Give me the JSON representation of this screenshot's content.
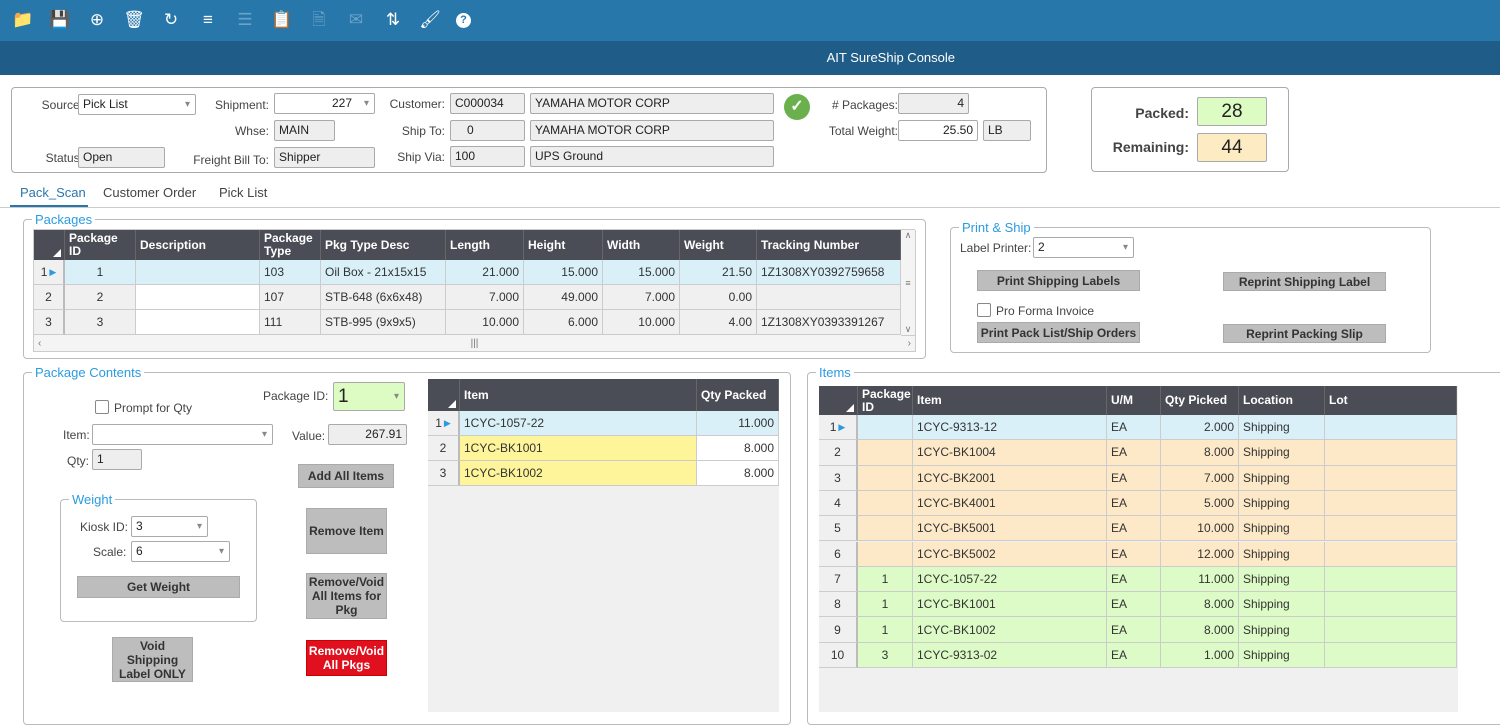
{
  "toolbar": {
    "icons": [
      {
        "name": "folder-open-icon",
        "glyph": "📁",
        "enabled": true
      },
      {
        "name": "save-icon",
        "glyph": "💾",
        "enabled": false
      },
      {
        "name": "crosshair-icon",
        "glyph": "⊕",
        "enabled": true
      },
      {
        "name": "trash-icon",
        "glyph": "🗑",
        "enabled": true
      },
      {
        "name": "refresh-icon",
        "glyph": "↻",
        "enabled": true
      },
      {
        "name": "filter-icon",
        "glyph": "≡",
        "enabled": true
      },
      {
        "name": "rows-icon",
        "glyph": "☰",
        "enabled": false
      },
      {
        "name": "clipboard-icon",
        "glyph": "📋",
        "enabled": false
      },
      {
        "name": "document-search-icon",
        "glyph": "🗎",
        "enabled": false
      },
      {
        "name": "envelope-icon",
        "glyph": "✉",
        "enabled": false
      },
      {
        "name": "box-arrow-icon",
        "glyph": "⇅",
        "enabled": true
      },
      {
        "name": "brush-icon",
        "glyph": "🖌",
        "enabled": true
      },
      {
        "name": "help-icon",
        "glyph": "?",
        "enabled": true
      }
    ]
  },
  "title": "AIT SureShip Console",
  "header": {
    "source_label": "Source:",
    "source": "Pick List",
    "status_label": "Status:",
    "status": "Open",
    "shipment_label": "Shipment:",
    "shipment": "227",
    "whse_label": "Whse:",
    "whse": "MAIN",
    "freight_label": "Freight Bill To:",
    "freight": "Shipper",
    "customer_label": "Customer:",
    "customer_id": "C000034",
    "customer_name": "YAMAHA MOTOR CORP",
    "shipto_label": "Ship To:",
    "shipto_id": "0",
    "shipto_name": "YAMAHA MOTOR CORP",
    "shipvia_label": "Ship Via:",
    "shipvia_id": "100",
    "shipvia_name": "UPS Ground",
    "packages_label": "# Packages:",
    "packages": "4",
    "weight_label": "Total Weight:",
    "weight": "25.50",
    "weight_unit": "LB",
    "status_icon": "check-circle-icon",
    "status_color": "#6ab04c"
  },
  "summary": {
    "packed_label": "Packed:",
    "packed": "28",
    "packed_color": "#dcfcc4",
    "remaining_label": "Remaining:",
    "remaining": "44",
    "remaining_color": "#fdebc4"
  },
  "tabs": [
    {
      "label": "Pack_Scan",
      "active": true
    },
    {
      "label": "Customer Order"
    },
    {
      "label": "Pick List"
    }
  ],
  "packages": {
    "legend": "Packages",
    "columns": [
      "Package ID",
      "Description",
      "Package Type",
      "Pkg Type Desc",
      "Length",
      "Height",
      "Width",
      "Weight",
      "Tracking Number"
    ],
    "rows": [
      [
        "1",
        "",
        "103",
        "Oil Box - 21x15x15",
        "21.000",
        "15.000",
        "15.000",
        "21.50",
        "1Z1308XY0392759658"
      ],
      [
        "2",
        "",
        "107",
        "STB-648 (6x6x48)",
        "7.000",
        "49.000",
        "7.000",
        "0.00",
        ""
      ],
      [
        "3",
        "",
        "111",
        "STB-995 (9x9x5)",
        "10.000",
        "6.000",
        "10.000",
        "4.00",
        "1Z1308XY0393391267"
      ]
    ]
  },
  "print_ship": {
    "legend": "Print & Ship",
    "printer_label": "Label Printer:",
    "printer": "2",
    "print_labels": "Print Shipping Labels",
    "reprint_label": "Reprint Shipping Label",
    "pro_forma": "Pro Forma Invoice",
    "print_pack": "Print Pack List/Ship Orders",
    "reprint_slip": "Reprint Packing Slip"
  },
  "contents": {
    "legend": "Package Contents",
    "prompt_qty": "Prompt for Qty",
    "package_id_label": "Package ID:",
    "package_id": "1",
    "item_label": "Item:",
    "item": "",
    "value_label": "Value:",
    "value": "267.91",
    "qty_label": "Qty:",
    "qty": "1",
    "add_all": "Add All Items",
    "remove_item": "Remove Item",
    "remove_void_pkg": "Remove/Void All Items for Pkg",
    "void_label": "Void Shipping Label ONLY",
    "remove_void_all": "Remove/Void All Pkgs",
    "weight": {
      "legend": "Weight",
      "kiosk_label": "Kiosk ID:",
      "kiosk": "3",
      "scale_label": "Scale:",
      "scale": "6",
      "get_weight": "Get Weight"
    },
    "columns": [
      "Item",
      "Qty Packed"
    ],
    "rows": [
      [
        "1CYC-1057-22",
        "11.000"
      ],
      [
        "1CYC-BK1001",
        "8.000"
      ],
      [
        "1CYC-BK1002",
        "8.000"
      ]
    ]
  },
  "items": {
    "legend": "Items",
    "columns": [
      "Package ID",
      "Item",
      "U/M",
      "Qty Picked",
      "Location",
      "Lot"
    ],
    "rows": [
      [
        "",
        "1CYC-9313-12",
        "EA",
        "2.000",
        "Shipping",
        ""
      ],
      [
        "",
        "1CYC-BK1004",
        "EA",
        "8.000",
        "Shipping",
        ""
      ],
      [
        "",
        "1CYC-BK2001",
        "EA",
        "7.000",
        "Shipping",
        ""
      ],
      [
        "",
        "1CYC-BK4001",
        "EA",
        "5.000",
        "Shipping",
        ""
      ],
      [
        "",
        "1CYC-BK5001",
        "EA",
        "10.000",
        "Shipping",
        ""
      ],
      [
        "",
        "1CYC-BK5002",
        "EA",
        "12.000",
        "Shipping",
        ""
      ],
      [
        "1",
        "1CYC-1057-22",
        "EA",
        "11.000",
        "Shipping",
        ""
      ],
      [
        "1",
        "1CYC-BK1001",
        "EA",
        "8.000",
        "Shipping",
        ""
      ],
      [
        "1",
        "1CYC-BK1002",
        "EA",
        "8.000",
        "Shipping",
        ""
      ],
      [
        "3",
        "1CYC-9313-02",
        "EA",
        "1.000",
        "Shipping",
        ""
      ]
    ]
  },
  "colors": {
    "selected_row": "#d9f0f8",
    "unpacked_row": "#fde9c8",
    "packed_row": "#dcfbc6",
    "new_item": "#fef59a",
    "danger": "#e0101e",
    "accent": "#2a9be0"
  }
}
